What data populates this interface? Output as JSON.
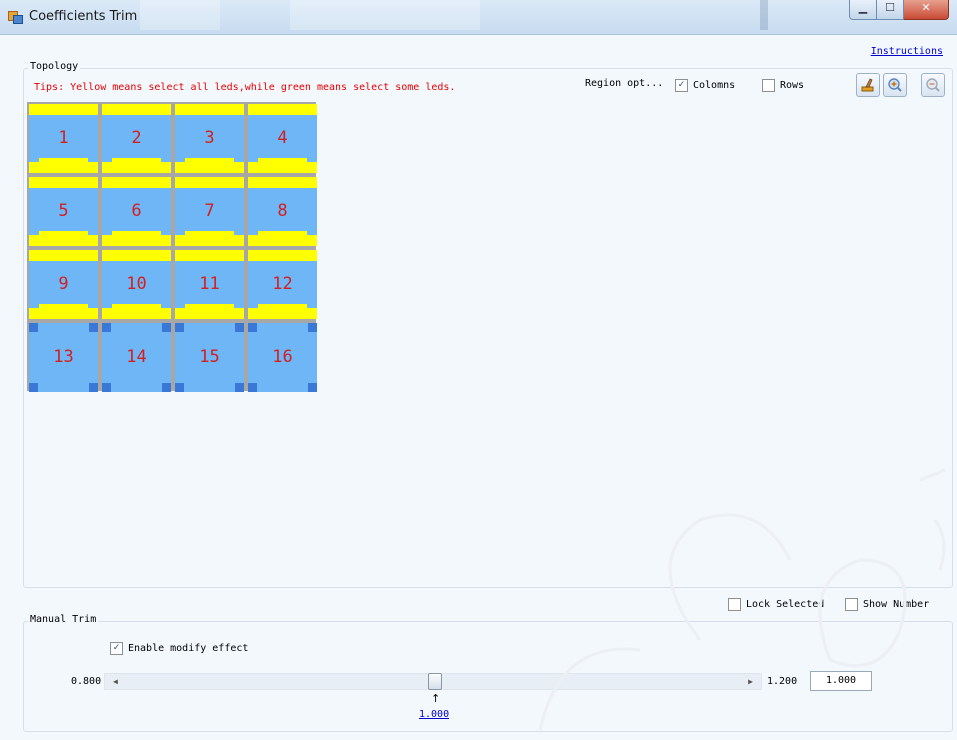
{
  "window": {
    "title": "Coefficients Trim"
  },
  "links": {
    "instructions": "Instructions"
  },
  "topology": {
    "legend": "Topology",
    "tips": "Tips: Yellow means select all leds,while green means select some leds.",
    "region_label": "Region opt...",
    "columns": {
      "label": "Colomns",
      "checked": true
    },
    "rows": {
      "label": "Rows",
      "checked": false
    },
    "tool_icons": [
      "brush-icon",
      "zoom-in-icon",
      "zoom-out-icon"
    ],
    "cells": [
      {
        "num": "1",
        "state": "yellow"
      },
      {
        "num": "2",
        "state": "yellow"
      },
      {
        "num": "3",
        "state": "yellow"
      },
      {
        "num": "4",
        "state": "yellow"
      },
      {
        "num": "5",
        "state": "yellow"
      },
      {
        "num": "6",
        "state": "yellow"
      },
      {
        "num": "7",
        "state": "yellow"
      },
      {
        "num": "8",
        "state": "yellow"
      },
      {
        "num": "9",
        "state": "yellow"
      },
      {
        "num": "10",
        "state": "yellow"
      },
      {
        "num": "11",
        "state": "yellow"
      },
      {
        "num": "12",
        "state": "yellow"
      },
      {
        "num": "13",
        "state": "none"
      },
      {
        "num": "14",
        "state": "none"
      },
      {
        "num": "15",
        "state": "none"
      },
      {
        "num": "16",
        "state": "none"
      }
    ]
  },
  "options": {
    "lock_selected": {
      "label": "Lock Selected",
      "checked": false
    },
    "show_number": {
      "label": "Show Number",
      "checked": false
    }
  },
  "manual_trim": {
    "legend": "Manual Trim",
    "enable": {
      "label": "Enable modify effect",
      "checked": true
    },
    "min": "0.800",
    "max": "1.200",
    "input_value": "1.000",
    "current_value": "1.000",
    "slider_value": 1.0
  },
  "colors": {
    "selected_yellow": "#ffff00",
    "cell_blue": "#6fb6f6",
    "number_red": "#d22020",
    "tips_red": "#e60000"
  }
}
